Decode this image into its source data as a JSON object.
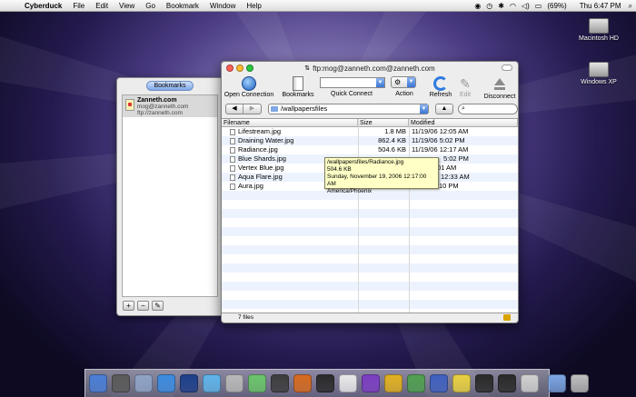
{
  "menubar": {
    "app_name": "Cyberduck",
    "items": [
      "File",
      "Edit",
      "View",
      "Go",
      "Bookmark",
      "Window",
      "Help"
    ],
    "battery": "(69%)",
    "clock": "Thu 6:47 PM"
  },
  "desktop": {
    "icons": [
      "Macintosh HD",
      "Windows XP"
    ]
  },
  "bookmarks_window": {
    "toggle_label": "Bookmarks",
    "entries": [
      {
        "name": "Zanneth.com",
        "user": "mog@zanneth.com",
        "url": "ftp://zanneth.com"
      }
    ],
    "footer_buttons": [
      "+",
      "−",
      "✎"
    ]
  },
  "main_window": {
    "title": "ftp:mog@zanneth.com@zanneth.com",
    "toolbar": {
      "open_connection": "Open Connection",
      "bookmarks": "Bookmarks",
      "quick_connect": "Quick Connect",
      "action": "Action",
      "refresh": "Refresh",
      "edit": "Edit",
      "disconnect": "Disconnect"
    },
    "path": "/wallpapersfiles",
    "columns": [
      "Filename",
      "Size",
      "Modified"
    ],
    "files": [
      {
        "name": "Lifestream.jpg",
        "size": "1.8 MB",
        "modified": "11/19/06 12:05 AM"
      },
      {
        "name": "Draining Water.jpg",
        "size": "862.4 KB",
        "modified": "11/19/06 5:02 PM"
      },
      {
        "name": "Radiance.jpg",
        "size": "504.6 KB",
        "modified": "11/19/06 12:17 AM"
      },
      {
        "name": "Blue Shards.jpg",
        "size": "",
        "modified": "5:02 PM"
      },
      {
        "name": "Vertex Blue.jpg",
        "size": "",
        "modified": "01 AM"
      },
      {
        "name": "Aqua Flare.jpg",
        "size": "",
        "modified": "12:33 AM"
      },
      {
        "name": "Aura.jpg",
        "size": "",
        "modified": "10 PM"
      }
    ],
    "status": "7 files"
  },
  "tooltip": {
    "path": "/wallpapersfiles/Radiance.jpg",
    "size": "504.6 KB",
    "date": "Sunday, November 19, 2006 12:17:00 AM",
    "timezone": "America/Phoenix"
  },
  "colors": {
    "close": "#ff5f57",
    "minimize": "#febc2e",
    "zoom": "#28c840",
    "tooltip_bg": "#ffffc6",
    "row_alt": "#edf3fe"
  },
  "dock": {
    "colors": [
      "#4a7ed6",
      "#5a5a5a",
      "#8fa3c7",
      "#3c8be0",
      "#1d3f8a",
      "#5fb3e8",
      "#b8b8b8",
      "#6ac46a",
      "#3d3d3d",
      "#d66a1f",
      "#2a2a2a",
      "#e8e8e8",
      "#7b3ec2",
      "#e0b020",
      "#4f9f4f",
      "#4060c0",
      "#e8d040",
      "#2a2a2a",
      "#2a2a2a",
      "#d0d0d0",
      "#7ea7e4",
      "#c0c0c0"
    ]
  }
}
